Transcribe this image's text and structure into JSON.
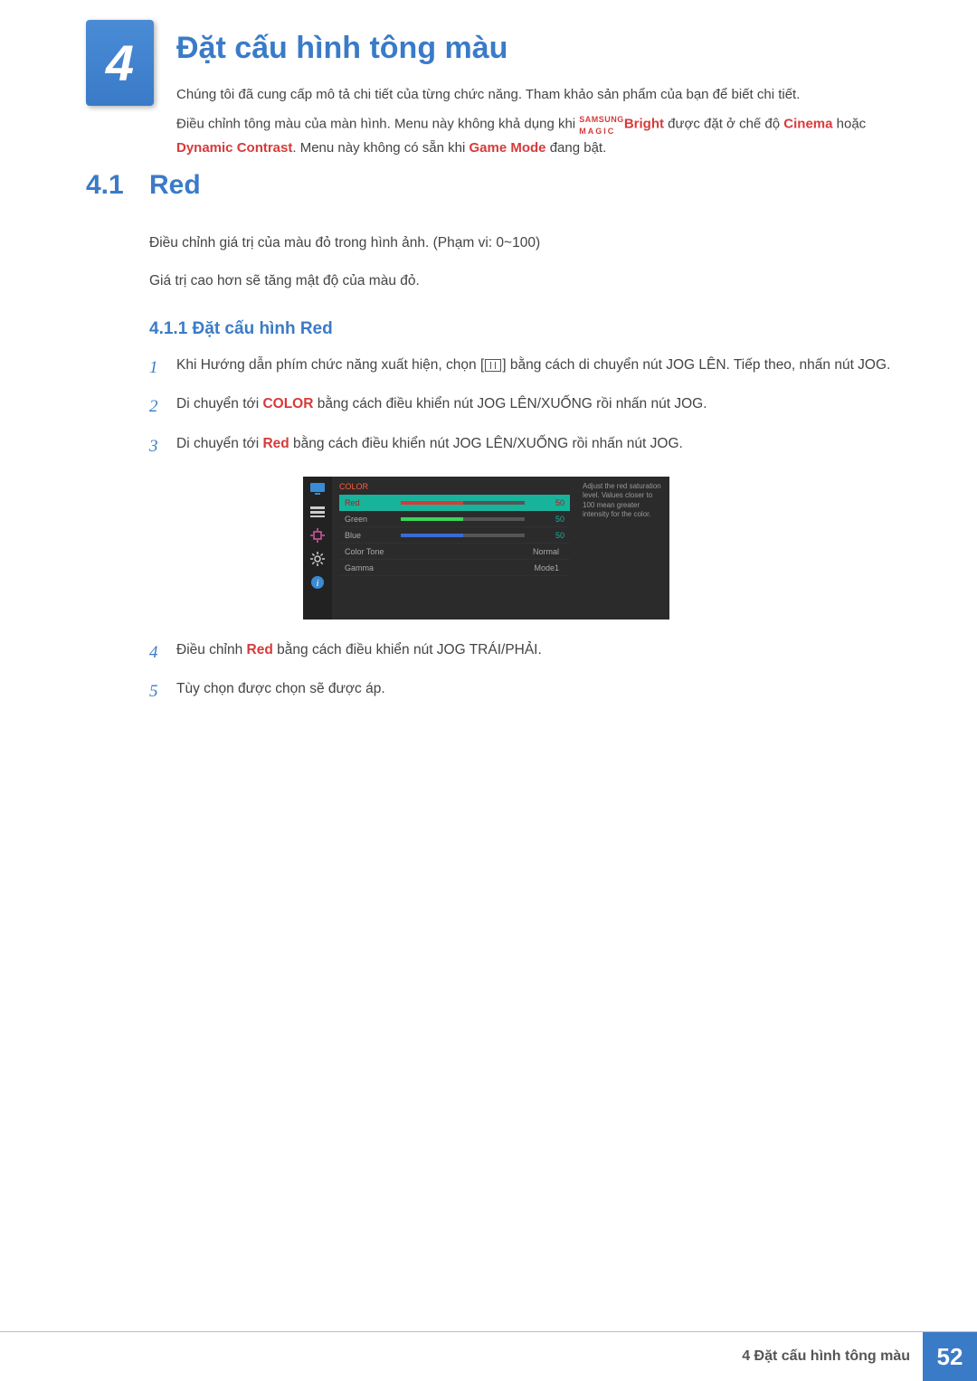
{
  "chapter": {
    "number": "4",
    "title": "Đặt cấu hình tông màu",
    "intro_line1": "Chúng tôi đã cung cấp mô tả chi tiết của từng chức năng. Tham khảo sản phẩm của bạn để biết chi tiết.",
    "intro_line2_a": "Điều chỉnh tông màu của màn hình. Menu này không khả dụng khi ",
    "intro_samsung": "SAMSUNG",
    "intro_magic": "MAGIC",
    "intro_bright": "Bright",
    "intro_line2_b": " được đặt ở chế độ ",
    "intro_cinema": "Cinema",
    "intro_or": " hoặc ",
    "intro_dc": "Dynamic Contrast",
    "intro_line2_c": ". Menu này không có sẵn khi ",
    "intro_gm": "Game Mode",
    "intro_line2_d": " đang bật."
  },
  "section": {
    "num": "4.1",
    "title": "Red",
    "p1": "Điều chỉnh giá trị của màu đỏ trong hình ảnh. (Phạm vi: 0~100)",
    "p2": "Giá trị cao hơn sẽ tăng mật độ của màu đỏ."
  },
  "subsection": {
    "heading": "4.1.1  Đặt cấu hình Red",
    "steps": [
      {
        "n": "1",
        "pre": "Khi Hướng dẫn phím chức năng xuất hiện, chọn [",
        "post": "] bằng cách di chuyển nút JOG LÊN. Tiếp theo, nhấn nút JOG.",
        "has_icon": true
      },
      {
        "n": "2",
        "pre": "Di chuyển tới ",
        "bold": "COLOR",
        "post": " bằng cách điều khiển nút JOG LÊN/XUỐNG rồi nhấn nút JOG."
      },
      {
        "n": "3",
        "pre": "Di chuyển tới ",
        "red": "Red",
        "post": " bằng cách điều khiển nút JOG LÊN/XUỐNG rồi nhấn nút JOG."
      }
    ],
    "steps_after": [
      {
        "n": "4",
        "pre": "Điều chỉnh ",
        "red": "Red",
        "post": " bằng cách điều khiển nút JOG TRÁI/PHẢI."
      },
      {
        "n": "5",
        "pre": "Tùy chọn được chọn sẽ được áp.",
        "post": ""
      }
    ]
  },
  "osd": {
    "title": "COLOR",
    "rows": [
      {
        "label": "Red",
        "value": "50",
        "type": "bar",
        "fill_color": "#d63a3a",
        "fill_pct": 50,
        "selected": true
      },
      {
        "label": "Green",
        "value": "50",
        "type": "bar",
        "fill_color": "#3ad65a",
        "fill_pct": 50
      },
      {
        "label": "Blue",
        "value": "50",
        "type": "bar",
        "fill_color": "#3a6ad6",
        "fill_pct": 50
      },
      {
        "label": "Color Tone",
        "value": "Normal",
        "type": "text"
      },
      {
        "label": "Gamma",
        "value": "Mode1",
        "type": "text"
      }
    ],
    "tip": "Adjust the red saturation level. Values closer to 100 mean greater intensity for the color."
  },
  "footer": {
    "label": "4 Đặt cấu hình tông màu",
    "page": "52"
  }
}
